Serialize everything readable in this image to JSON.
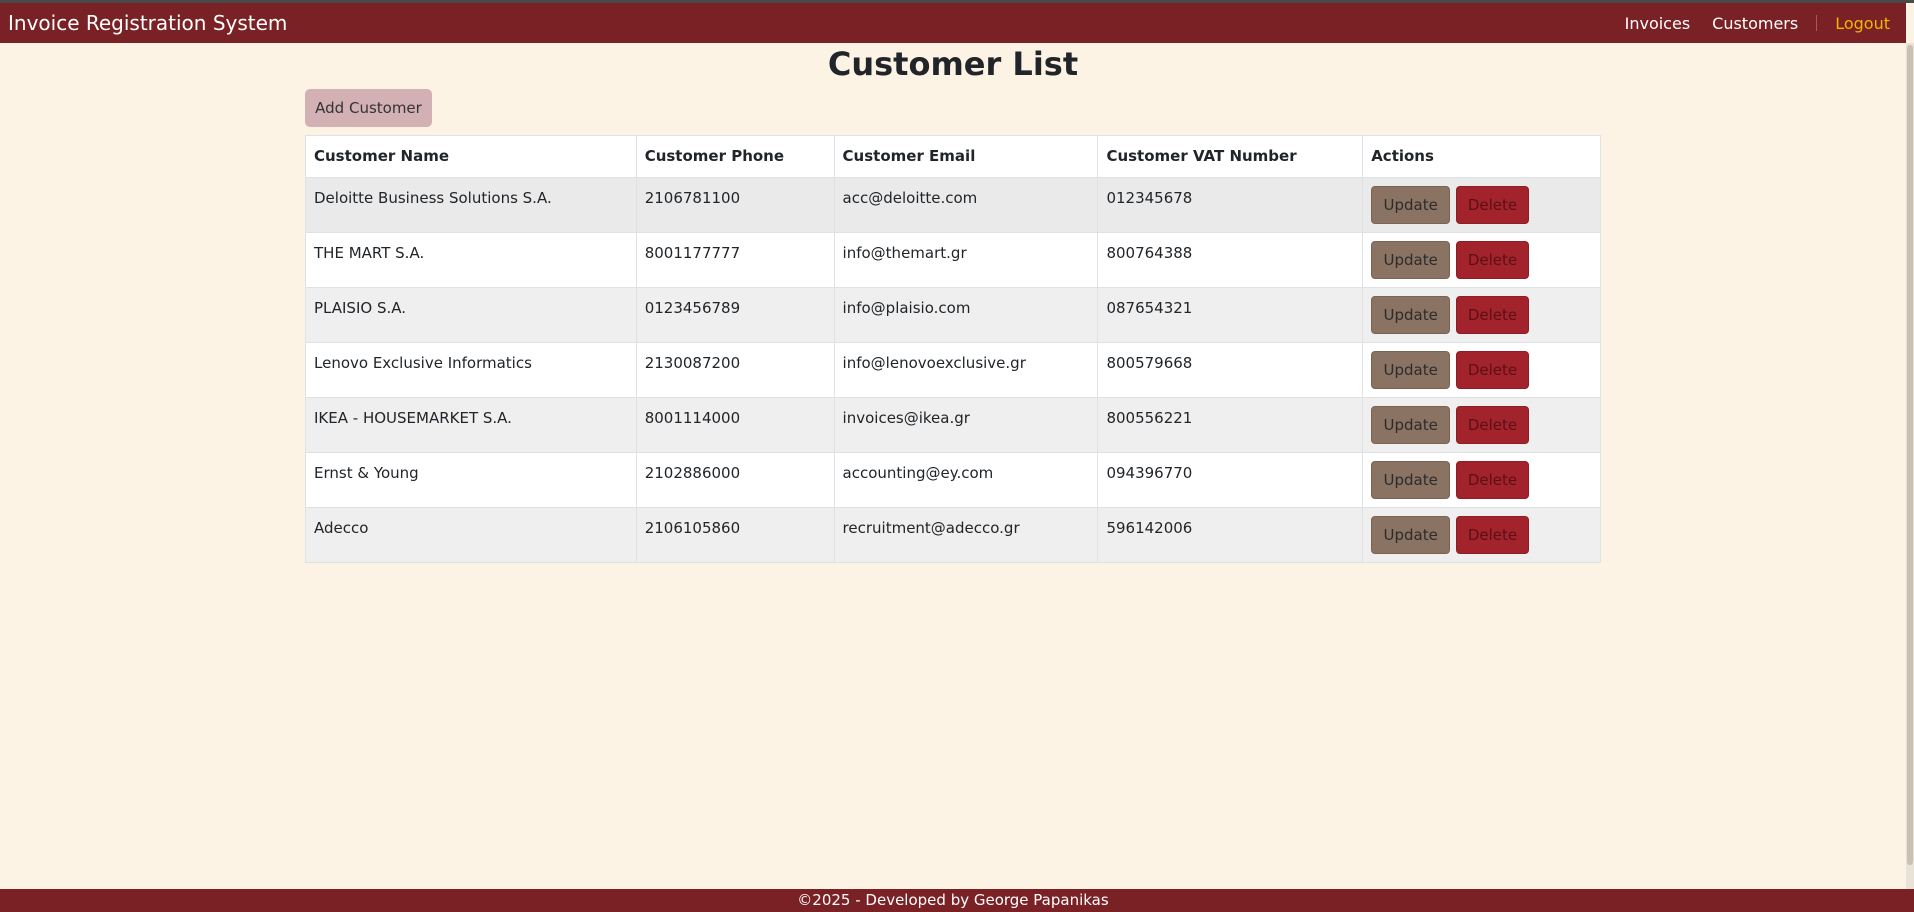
{
  "navbar": {
    "brand": "Invoice Registration System",
    "links": [
      "Invoices",
      "Customers"
    ],
    "logout": "Logout"
  },
  "page": {
    "title": "Customer List",
    "add_button": "Add Customer"
  },
  "table": {
    "headers": [
      "Customer Name",
      "Customer Phone",
      "Customer Email",
      "Customer VAT Number",
      "Actions"
    ],
    "rows": [
      [
        "Deloitte Business Solutions S.A.",
        "2106781100",
        "acc@deloitte.com",
        "012345678"
      ],
      [
        "THE MART S.A.",
        "8001177777",
        "info@themart.gr",
        "800764388"
      ],
      [
        "PLAISIO S.A.",
        "0123456789",
        "info@plaisio.com",
        "087654321"
      ],
      [
        "Lenovo Exclusive Informatics",
        "2130087200",
        "info@lenovoexclusive.gr",
        "800579668"
      ],
      [
        "IKEA - HOUSEMARKET S.A.",
        "8001114000",
        "invoices@ikea.gr",
        "800556221"
      ],
      [
        "Ernst & Young",
        "2102886000",
        "accounting@ey.com",
        "094396770"
      ],
      [
        "Adecco",
        "2106105860",
        "recruitment@adecco.gr",
        "596142006"
      ]
    ],
    "update_label": "Update",
    "delete_label": "Delete"
  },
  "footer": {
    "text": "©2025 - Developed by George Papanikas"
  },
  "colors": {
    "navbar": "#7a2126",
    "background": "#fdf3e4",
    "logout": "#f4b400",
    "update_button": "#8b7363",
    "delete_button": "#a3232c",
    "add_button": "#d3b0b3"
  }
}
